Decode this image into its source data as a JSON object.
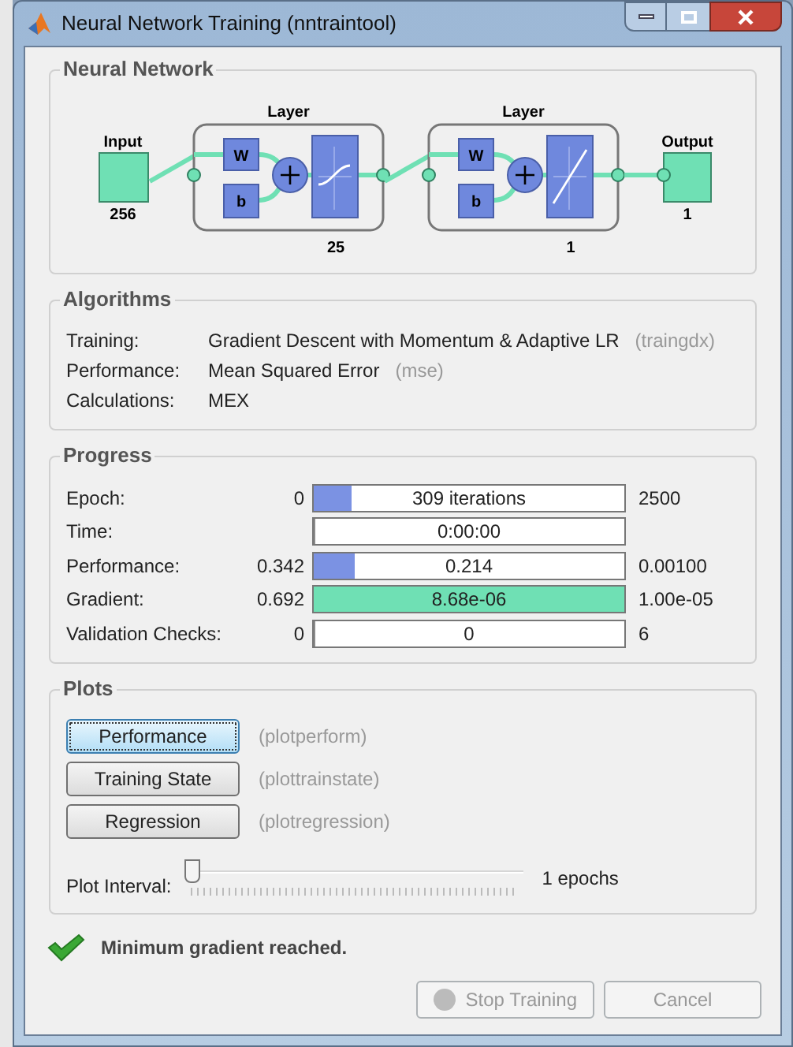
{
  "window": {
    "title": "Neural Network Training (nntraintool)"
  },
  "neural_network": {
    "title": "Neural Network",
    "input": {
      "label": "Input",
      "size": "256"
    },
    "layers": [
      {
        "label": "Layer",
        "size": "25",
        "weight": "W",
        "bias": "b",
        "kind": "sigmoid"
      },
      {
        "label": "Layer",
        "size": "1",
        "weight": "W",
        "bias": "b",
        "kind": "linear"
      }
    ],
    "output": {
      "label": "Output",
      "size": "1"
    }
  },
  "algorithms": {
    "title": "Algorithms",
    "rows": [
      {
        "label": "Training:",
        "value": "Gradient Descent with Momentum & Adaptive LR",
        "function": "(traingdx)"
      },
      {
        "label": "Performance:",
        "value": "Mean Squared Error",
        "function": "(mse)"
      },
      {
        "label": "Calculations:",
        "value": "MEX"
      }
    ]
  },
  "progress": {
    "title": "Progress",
    "rows": [
      {
        "label": "Epoch:",
        "start": "0",
        "value": "309 iterations",
        "end": "2500",
        "level": 0.124,
        "color": "#7b92e3"
      },
      {
        "label": "Time:",
        "value": "0:00:00",
        "level": 0
      },
      {
        "label": "Performance:",
        "start": "0.342",
        "value": "0.214",
        "end": "0.00100",
        "level": 0.13,
        "color": "#7b92e3"
      },
      {
        "label": "Gradient:",
        "start": "0.692",
        "value": "8.68e-06",
        "end": "1.00e-05",
        "level": 1,
        "color": "#6fe0b4"
      },
      {
        "label": "Validation Checks:",
        "start": "0",
        "value": "0",
        "end": "6",
        "level": 0
      }
    ]
  },
  "plots": {
    "title": "Plots",
    "buttons": [
      {
        "label": "Performance",
        "function": "(plotperform)",
        "selected": true
      },
      {
        "label": "Training State",
        "function": "(plottrainstate)",
        "selected": false
      },
      {
        "label": "Regression",
        "function": "(plotregression)",
        "selected": false
      }
    ],
    "plot_interval": {
      "label": "Plot Interval:",
      "level": 0,
      "reading": "1 epochs"
    }
  },
  "status": {
    "kind": "success",
    "text": "Minimum gradient reached."
  },
  "buttons": [
    {
      "label": "Stop Training",
      "disabled": true
    },
    {
      "label": "Cancel",
      "disabled": true
    }
  ]
}
